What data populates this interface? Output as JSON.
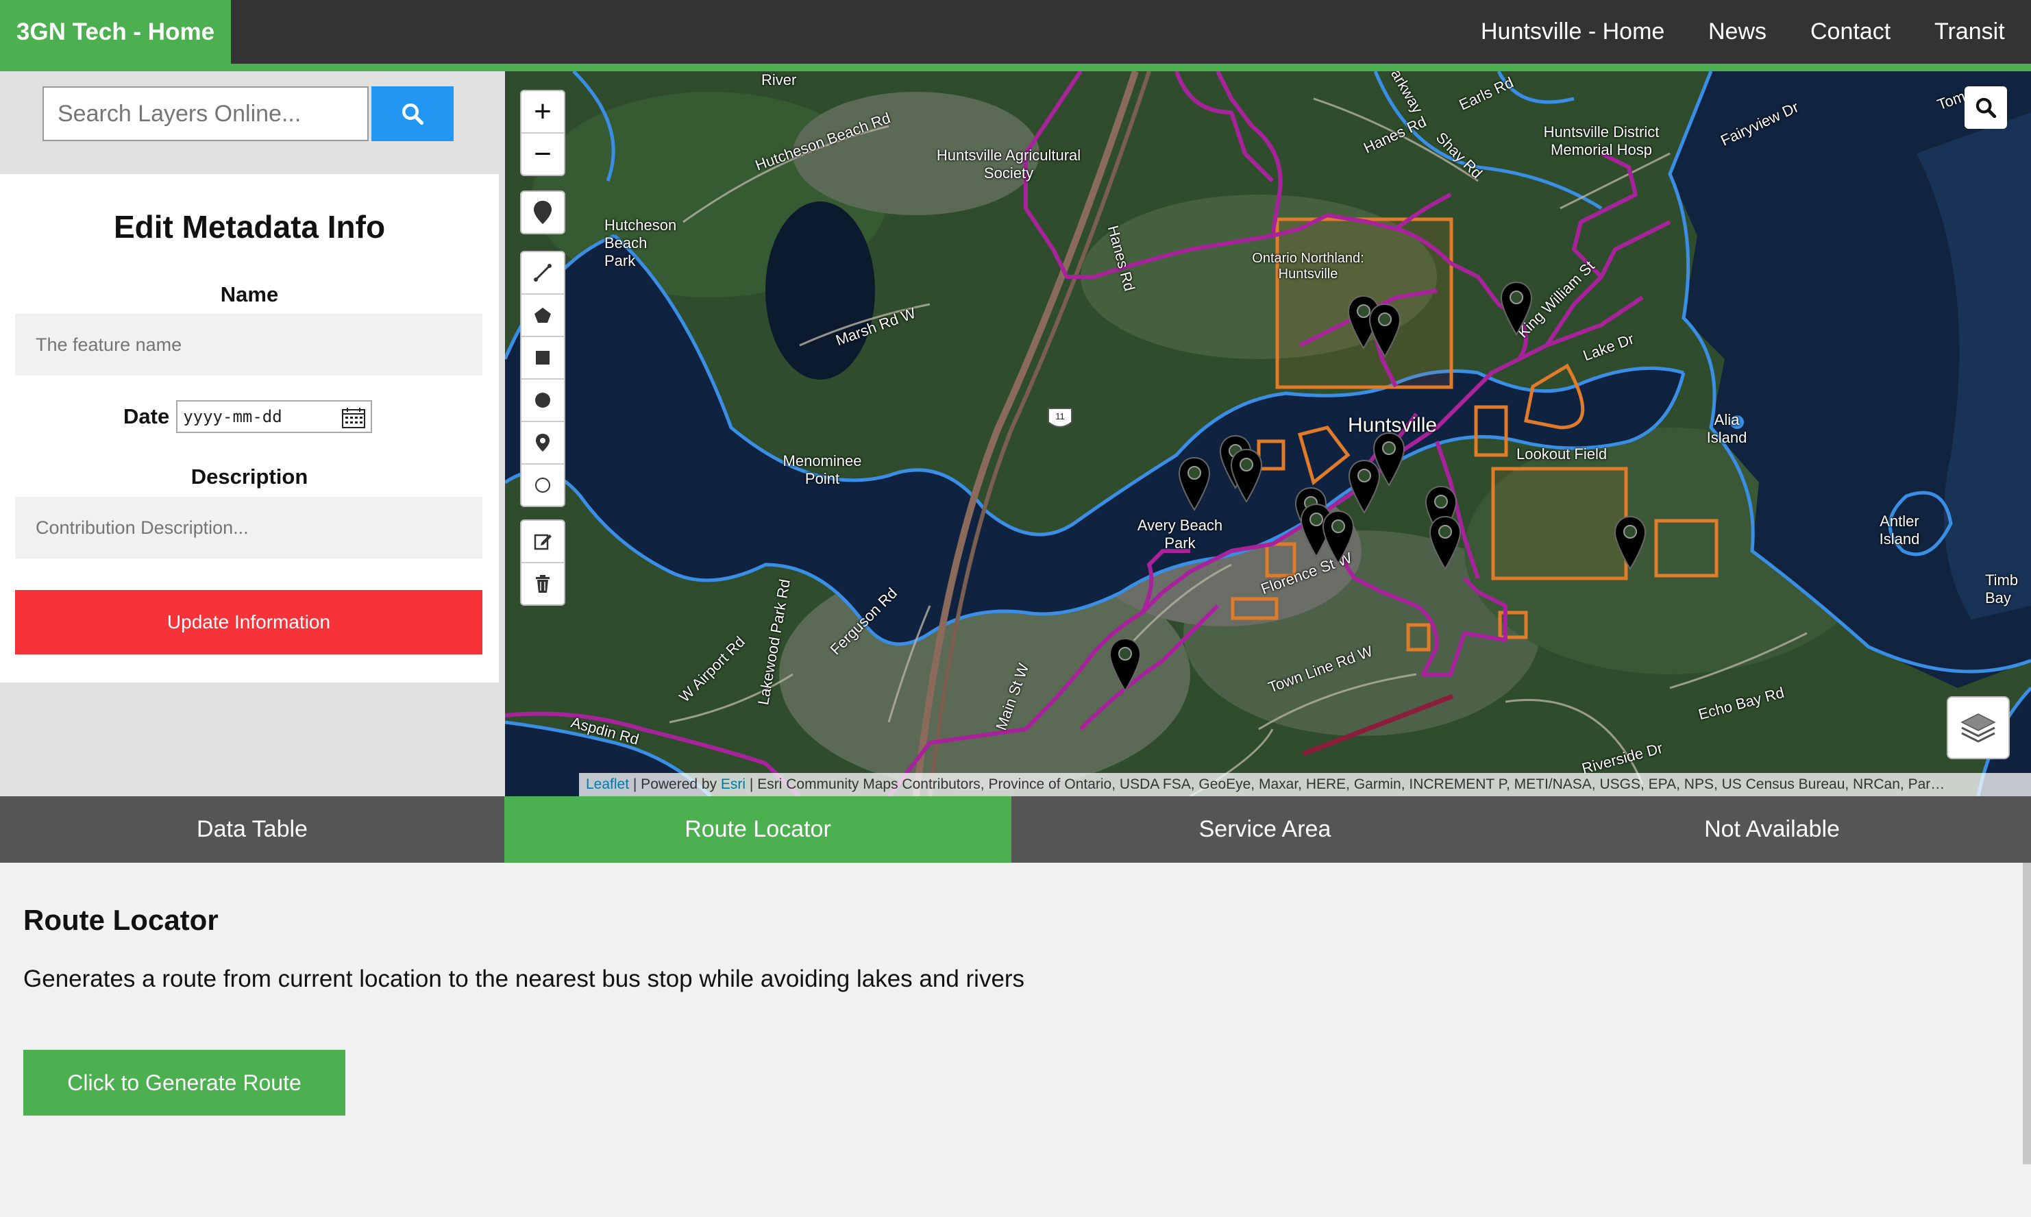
{
  "nav": {
    "brand": "3GN Tech - Home",
    "links": [
      "Huntsville - Home",
      "News",
      "Contact",
      "Transit"
    ],
    "bg_color": "#333333",
    "accent_color": "#4caf50"
  },
  "sidebar": {
    "search_placeholder": "Search Layers Online...",
    "search_icon": "search-icon"
  },
  "form": {
    "title": "Edit Metadata Info",
    "name_label": "Name",
    "name_placeholder": "The feature name",
    "date_label": "Date",
    "date_placeholder": "yyyy-mm-dd",
    "description_label": "Description",
    "description_placeholder": "Contribution Description...",
    "submit_label": "Update Information",
    "submit_color": "#f63338"
  },
  "map": {
    "zoom_in": "+",
    "zoom_out": "−",
    "draw_tools": [
      "marker-icon",
      "polyline-icon",
      "polygon-icon",
      "rectangle-icon",
      "circle-icon",
      "circlemarker-icon",
      "circle-outline-icon"
    ],
    "edit_tools": [
      "edit-icon",
      "trash-icon"
    ],
    "labels": [
      "Huntsville",
      "Huntsville Agricultural Society",
      "Hutcheson Beach Park",
      "Hutcheson Beach Rd",
      "Marsh Rd W",
      "Menominee Point",
      "Avery Beach Park",
      "Ontario Northland: Huntsville",
      "Huntsville District Memorial Hosp",
      "Lookout Field",
      "Alia Island",
      "Antler Island",
      "Hanes Rd",
      "Earls Rd",
      "Shay Rd",
      "Fairyview Dr",
      "Lake Dr",
      "King William St",
      "Florence St W",
      "Town Line Rd W",
      "Echo Bay Rd",
      "Riverside Dr",
      "Aspdin Rd",
      "W Airport Rd",
      "Lakewood Park Rd",
      "Ferguson Rd",
      "Main St W",
      "Hanes Rd",
      "Parkway",
      "River",
      "Tom",
      "Timb Bay",
      "11"
    ],
    "attribution_link1": "Leaflet",
    "attribution_sep": " | Powered by ",
    "attribution_link2": "Esri",
    "attribution_rest": " | Esri Community Maps Contributors, Province of Ontario, USDA FSA, GeoEye, Maxar, HERE, Garmin, INCREMENT P, METI/NASA, USGS, EPA, NPS, US Census Bureau, NRCan, Par…",
    "route_color": "#a8239b",
    "water_outline_color": "#3a8ee6",
    "area_color": "#e07b2a"
  },
  "tabs": {
    "items": [
      "Data Table",
      "Route Locator",
      "Service Area",
      "Not Available"
    ],
    "active": "Route Locator"
  },
  "content": {
    "title": "Route Locator",
    "description": "Generates a route from current location to the nearest bus stop while avoiding lakes and rivers",
    "button_label": "Click to Generate Route"
  }
}
